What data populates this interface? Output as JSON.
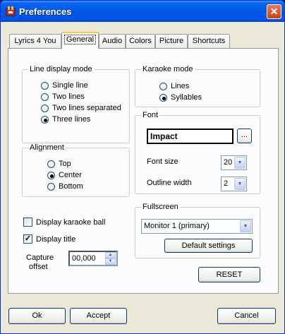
{
  "window": {
    "title": "Preferences",
    "close_glyph": "✕"
  },
  "tabs": [
    "Lyrics 4 You",
    "General",
    "Audio",
    "Colors",
    "Picture",
    "Shortcuts"
  ],
  "active_tab": "General",
  "line_display": {
    "title": "Line display mode",
    "options": [
      "Single line",
      "Two lines",
      "Two lines separated",
      "Three lines"
    ],
    "selected": "Three lines"
  },
  "alignment": {
    "title": "Alignment",
    "options": [
      "Top",
      "Center",
      "Bottom"
    ],
    "selected": "Center"
  },
  "karaoke_mode": {
    "title": "Karaoke mode",
    "options": [
      "Lines",
      "Syllables"
    ],
    "selected": "Syllables"
  },
  "font": {
    "title": "Font",
    "font_name": "Impact",
    "browse_label": "...",
    "size_label": "Font size",
    "size_value": "20",
    "outline_label": "Outline width",
    "outline_value": "2"
  },
  "fullscreen": {
    "title": "Fullscreen",
    "monitor": "Monitor 1 (primary)",
    "default_settings_label": "Default settings"
  },
  "options": {
    "karaoke_ball_label": "Display karaoke ball",
    "karaoke_ball_checked": false,
    "display_title_label": "Display title",
    "display_title_checked": true
  },
  "capture": {
    "label_line1": "Capture",
    "label_line2": "offset",
    "value": "00,000"
  },
  "buttons": {
    "reset": "RESET",
    "ok": "Ok",
    "accept": "Accept",
    "cancel": "Cancel"
  }
}
